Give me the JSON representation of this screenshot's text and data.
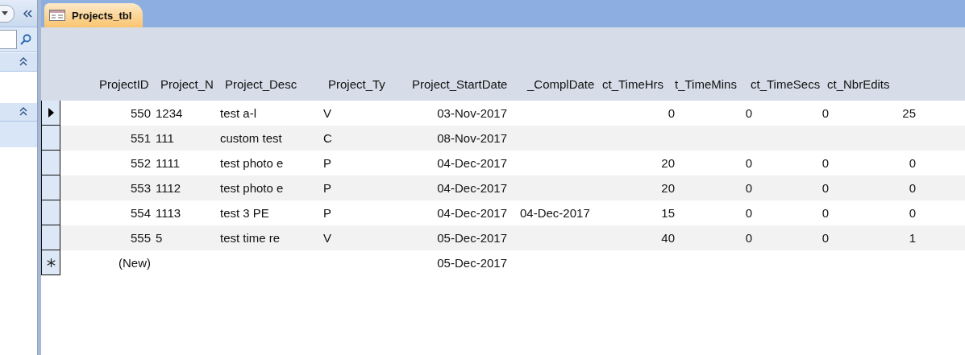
{
  "tab": {
    "title": "Projects_tbl",
    "selected": true
  },
  "table": {
    "columns": [
      "ProjectID",
      "Project_N",
      "Project_Desc",
      "Project_Ty",
      "Project_StartDate",
      "_ComplDate",
      "ct_TimeHrs",
      "t_TimeMins",
      "ct_TimeSecs",
      "ct_NbrEdits"
    ],
    "rows": [
      {
        "kind": "record",
        "selected": true,
        "cells": [
          "550",
          "1234",
          "test a-l",
          "V",
          "03-Nov-2017",
          "",
          "0",
          "0",
          "0",
          "25"
        ]
      },
      {
        "kind": "record",
        "selected": false,
        "cells": [
          "551",
          "111",
          "custom test",
          "C",
          "08-Nov-2017",
          "",
          "",
          "",
          "",
          ""
        ]
      },
      {
        "kind": "record",
        "selected": false,
        "cells": [
          "552",
          "1111",
          "test photo e",
          "P",
          "04-Dec-2017",
          "",
          "20",
          "0",
          "0",
          "0"
        ]
      },
      {
        "kind": "record",
        "selected": false,
        "cells": [
          "553",
          "1112",
          "test photo e",
          "P",
          "04-Dec-2017",
          "",
          "20",
          "0",
          "0",
          "0"
        ]
      },
      {
        "kind": "record",
        "selected": false,
        "cells": [
          "554",
          "1113",
          "test 3 PE",
          "P",
          "04-Dec-2017",
          "04-Dec-2017",
          "15",
          "0",
          "0",
          "0"
        ]
      },
      {
        "kind": "record",
        "selected": false,
        "cells": [
          "555",
          "5",
          "test time re",
          "V",
          "05-Dec-2017",
          "",
          "40",
          "0",
          "0",
          "1"
        ]
      },
      {
        "kind": "new",
        "cells": [
          "(New)",
          "",
          "",
          "",
          "05-Dec-2017",
          "",
          "",
          "",
          "",
          ""
        ]
      }
    ]
  }
}
